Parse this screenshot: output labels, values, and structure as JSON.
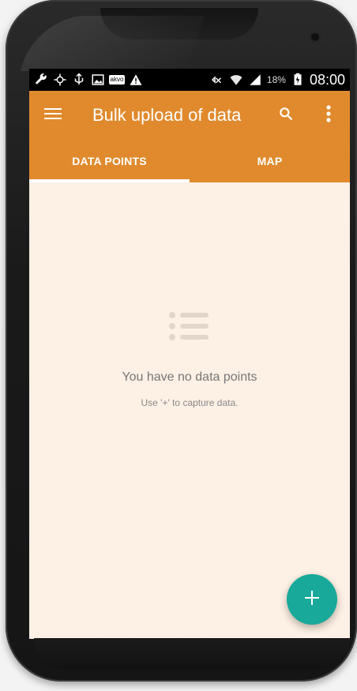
{
  "status_bar": {
    "icons_left": [
      "wrench-icon",
      "gps-icon",
      "usb-icon",
      "image-icon",
      "akvo-icon",
      "warning-icon"
    ],
    "akvo_label": "akvo",
    "icons_right": [
      "mute-icon",
      "wifi-icon",
      "signal-icon",
      "battery-icon"
    ],
    "battery_percent": "18%",
    "time": "08:00"
  },
  "app_bar": {
    "title": "Bulk upload of data",
    "menu_icon": "hamburger-icon",
    "search_icon": "search-icon",
    "overflow_icon": "more-vert-icon"
  },
  "tabs": [
    {
      "label": "DATA POINTS",
      "selected": true
    },
    {
      "label": "MAP",
      "selected": false
    }
  ],
  "empty_state": {
    "icon": "list-icon",
    "title": "You have no data points",
    "subtitle": "Use '+' to capture data."
  },
  "fab": {
    "icon": "plus-icon",
    "color": "#19a99a"
  },
  "colors": {
    "app_bar": "#e08a2d",
    "content_bg": "#fdf0e4",
    "fab": "#19a99a"
  }
}
